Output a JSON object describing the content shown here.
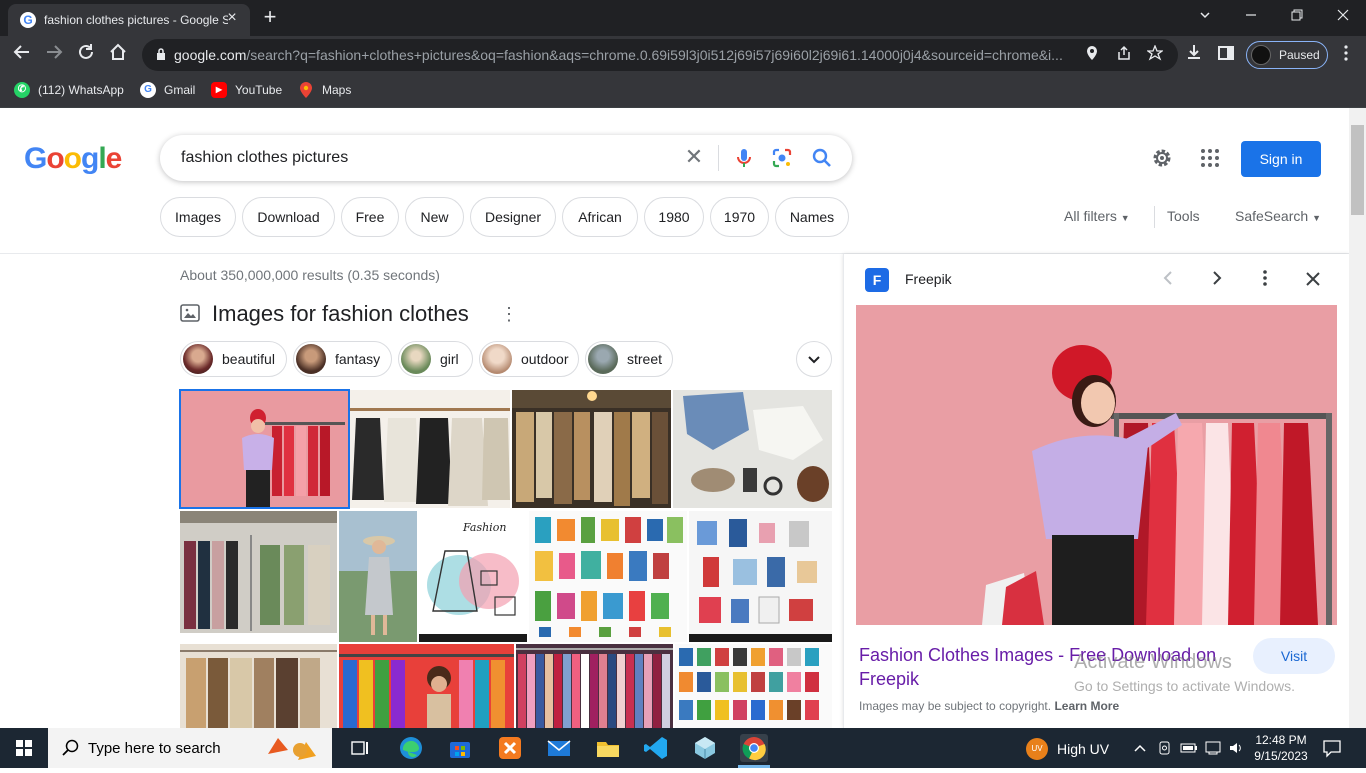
{
  "browser": {
    "tab_title": "fashion clothes pictures - Google Search",
    "tab_close": "×",
    "new_tab": "+",
    "url_host": "google.com",
    "url_rest": "/search?q=fashion+clothes+pictures&oq=fashion&aqs=chrome.0.69i59l3j0i512j69i57j69i60l2j69i61.14000j0j4&sourceid=chrome&i...",
    "profile_status": "Paused",
    "bookmarks": [
      {
        "label": "(112) WhatsApp",
        "icon": "whatsapp-icon",
        "color": "#25d366"
      },
      {
        "label": "Gmail",
        "icon": "google-icon",
        "color": "#ffffff"
      },
      {
        "label": "YouTube",
        "icon": "youtube-icon",
        "color": "#ff0000"
      },
      {
        "label": "Maps",
        "icon": "maps-icon",
        "color": "#34a853"
      }
    ]
  },
  "google": {
    "search_query": "fashion clothes pictures",
    "sign_in": "Sign in",
    "chips": [
      "Images",
      "Download",
      "Free",
      "New",
      "Designer",
      "African",
      "1980",
      "1970",
      "Names"
    ],
    "all_filters": "All filters",
    "tools": "Tools",
    "safesearch": "SafeSearch",
    "stats": "About 350,000,000 results (0.35 seconds)",
    "images_heading": "Images for fashion clothes",
    "refine_chips": [
      "beautiful",
      "fantasy",
      "girl",
      "outdoor",
      "street"
    ]
  },
  "panel": {
    "source": "Freepik",
    "title": "Fashion Clothes Images - Free Download on Freepik",
    "visit": "Visit",
    "copyright": "Images may be subject to copyright.",
    "learn_more": "Learn More"
  },
  "watermark": {
    "line1": "Activate Windows",
    "line2": "Go to Settings to activate Windows."
  },
  "taskbar": {
    "search_placeholder": "Type here to search",
    "weather": "High UV",
    "time": "12:48 PM",
    "date": "9/15/2023"
  },
  "colors": {
    "google_blue": "#4285f4",
    "google_red": "#ea4335",
    "google_yellow": "#fbbc05",
    "google_green": "#34a853",
    "link_visited": "#681da8",
    "signin_bg": "#1a73e8"
  }
}
